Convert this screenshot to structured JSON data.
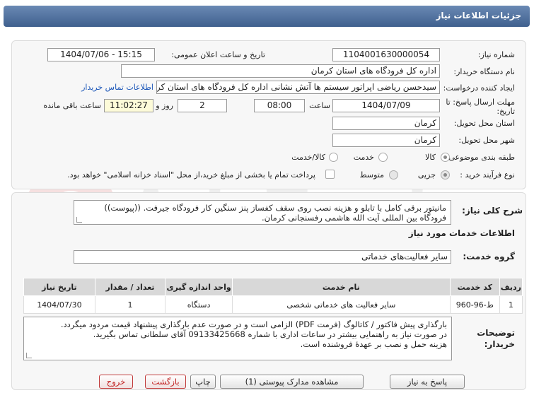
{
  "header": {
    "title": "جزئیات اطلاعات نیاز"
  },
  "fields": {
    "need_number_label": "شماره نیاز:",
    "need_number": "1104001630000054",
    "announce_label": "تاریخ و ساعت اعلان عمومی:",
    "announce_value": "1404/07/06 - 15:15",
    "buyer_org_label": "نام دستگاه خریدار:",
    "buyer_org": "اداره کل فرودگاه های استان کرمان",
    "creator_label": "ایجاد کننده درخواست:",
    "creator": "سیدحسن ریاضی اپراتور سیستم ها آتش نشانی اداره کل فرودگاه های استان کرمان",
    "contact_link": "اطلاعات تماس خریدار",
    "deadline_label": "مهلت ارسال پاسخ: تا تاریخ:",
    "deadline_date": "1404/07/09",
    "time_label": "ساعت",
    "deadline_time": "08:00",
    "days_value": "2",
    "days_label": "روز و",
    "remaining_time": "11:02:27",
    "remaining_label": "ساعت باقی مانده",
    "province_label": "استان محل تحویل:",
    "province": "کرمان",
    "city_label": "شهر محل تحویل:",
    "city": "کرمان",
    "category_label": "طبقه بندی موضوعی:",
    "category_options": [
      "کالا",
      "خدمت",
      "کالا/خدمت"
    ],
    "process_label": "نوع فرآیند خرید :",
    "process_options": [
      "جزیی",
      "متوسط"
    ],
    "payment_note": "پرداخت تمام یا بخشی از مبلغ خرید،از محل \"اسناد خزانه اسلامی\" خواهد بود."
  },
  "description": {
    "label": "شرح کلی نیاز:",
    "line1": "مانیتور برقی کامل با تابلو و هزینه نصب روی سقف کفساز پنز سنگین کار فرودگاه جیرفت. ((پیوست))",
    "line2": "فرودگاه بین المللی آیت الله هاشمی رفسنجانی کرمان."
  },
  "services": {
    "section_title": "اطلاعات خدمات مورد نیاز",
    "group_label": "گروه خدمت:",
    "group_value": "سایر فعالیت‌های خدماتی",
    "table": {
      "headers": [
        "ردیف",
        "کد خدمت",
        "نام خدمت",
        "واحد اندازه گیری",
        "تعداد / مقدار",
        "تاریخ نیاز"
      ],
      "rows": [
        [
          "1",
          "ط-96-960",
          "سایر فعالیت های خدماتی شخصی",
          "دستگاه",
          "1",
          "1404/07/30"
        ]
      ]
    }
  },
  "buyer_notes": {
    "label": "توضیحات خریدار:",
    "line1": "بارگذاری پیش فاکتور / کاتالوگ (فرمت PDF) الزامی است و در صورت عدم بارگذاری پیشنهاد قیمت مردود میگردد.",
    "line2": "در صورت نیاز به راهنمایی بیشتر در ساعات اداری با شماره 09133425668 آقای سلطانی  تماس بگیرید.",
    "line3": "هزینه حمل و نصب بر عهدهٔ فروشنده است."
  },
  "buttons": {
    "reply": "پاسخ به نیاز",
    "attachments": "مشاهده مدارک پیوستی (1)",
    "print": "چاپ",
    "back": "بازگشت",
    "exit": "خروج"
  },
  "watermark": {
    "text": "AriaTender.net"
  },
  "colors": {
    "header": "#4d6d9a",
    "panel": "#f7f7f7",
    "link": "#1a55b8",
    "exit": "#c02020"
  }
}
